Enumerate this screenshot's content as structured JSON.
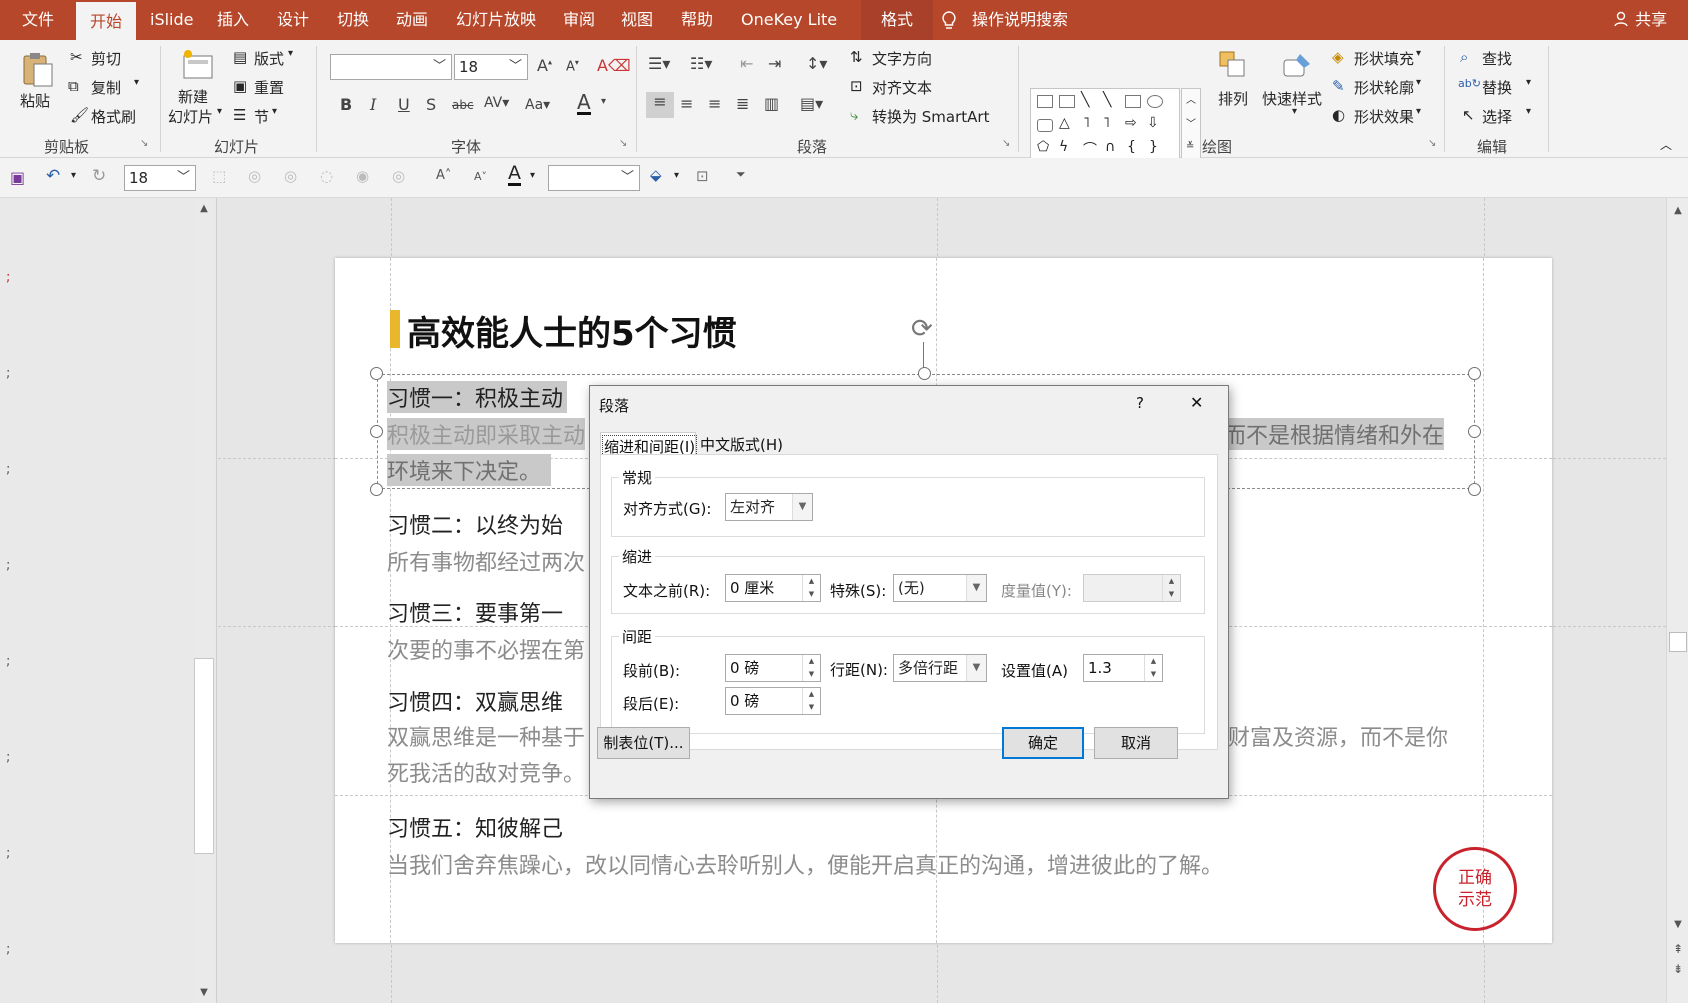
{
  "tabs": [
    "文件",
    "开始",
    "iSlide",
    "插入",
    "设计",
    "切换",
    "动画",
    "幻灯片放映",
    "审阅",
    "视图",
    "帮助",
    "OneKey Lite",
    "格式"
  ],
  "tell_me": "操作说明搜索",
  "share": "共享",
  "ribbon": {
    "clipboard": {
      "paste": "粘贴",
      "cut": "剪切",
      "copy": "复制",
      "format_painter": "格式刷",
      "group": "剪贴板"
    },
    "slides": {
      "new_slide_1": "新建",
      "new_slide_2": "幻灯片",
      "layout": "版式",
      "reset": "重置",
      "section": "节",
      "group": "幻灯片"
    },
    "font": {
      "font_name": "",
      "font_size": "18",
      "group": "字体"
    },
    "paragraph": {
      "text_direction": "文字方向",
      "align_text": "对齐文本",
      "convert_smartart": "转换为 SmartArt",
      "group": "段落"
    },
    "drawing": {
      "arrange": "排列",
      "quick_styles": "快速样式",
      "shape_fill": "形状填充",
      "shape_outline": "形状轮廓",
      "shape_effects": "形状效果",
      "group": "绘图"
    },
    "editing": {
      "find": "查找",
      "replace": "替换",
      "select": "选择",
      "group": "编辑"
    }
  },
  "qat": {
    "font_size": "18",
    "font_name": ""
  },
  "slide": {
    "title": "高效能人士的5个习惯",
    "habits": [
      {
        "title": "习惯一：积极主动",
        "desc_l1_left": "积极主动即采取主动",
        "desc_l1_right": "而不是根据情绪和外在",
        "desc_l2": "环境来下决定。"
      },
      {
        "title": "习惯二：以终为始",
        "desc_l1_left": "所有事物都经过两次"
      },
      {
        "title": "习惯三：要事第一",
        "desc_l1_left": "次要的事不必摆在第"
      },
      {
        "title": "习惯四：双赢思维",
        "desc_l1_left": "双赢思维是一种基于",
        "desc_l1_right": "财富及资源，而不是你",
        "desc_l2": "死我活的敌对竞争。"
      },
      {
        "title": "习惯五：知彼解己",
        "desc_l1_left": "当我们舍弃焦躁心，改以同情心去聆听别人，便能开启真正的沟通，增进彼此的了解。"
      }
    ],
    "seal": {
      "line1": "正确",
      "line2": "示范"
    }
  },
  "dialog": {
    "title": "段落",
    "help": "?",
    "close": "✕",
    "tabs": [
      "缩进和间距(I)",
      "中文版式(H)"
    ],
    "general": {
      "legend": "常规",
      "align_label": "对齐方式(G):",
      "align_value": "左对齐"
    },
    "indent": {
      "legend": "缩进",
      "before_text_label": "文本之前(R):",
      "before_text_value": "0 厘米",
      "special_label": "特殊(S):",
      "special_value": "(无)",
      "by_label": "度量值(Y):",
      "by_value": ""
    },
    "spacing": {
      "legend": "间距",
      "before_label": "段前(B):",
      "before_value": "0 磅",
      "after_label": "段后(E):",
      "after_value": "0 磅",
      "line_label": "行距(N):",
      "line_value": "多倍行距",
      "at_label": "设置值(A)",
      "at_value": "1.3"
    },
    "tabs_button": "制表位(T)...",
    "ok": "确定",
    "cancel": "取消"
  },
  "colors": {
    "accent": "#b7472a",
    "title_bar": "#e9b72b",
    "seal": "#c8232c"
  }
}
